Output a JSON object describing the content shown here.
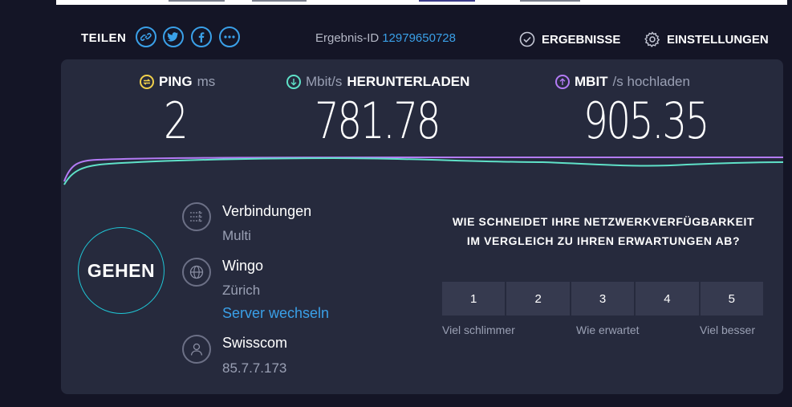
{
  "header": {
    "share_label": "TEILEN",
    "share_buttons": [
      {
        "icon": "link-icon",
        "glyph": "🔗"
      },
      {
        "icon": "twitter-icon",
        "glyph": "t"
      },
      {
        "icon": "facebook-icon",
        "glyph": "f"
      },
      {
        "icon": "more-icon",
        "glyph": "•••"
      }
    ],
    "result_id_label": "Ergebnis-ID",
    "result_id_value": "12979650728",
    "results_label": "ERGEBNISSE",
    "settings_label": "EINSTELLUNGEN"
  },
  "metrics": {
    "ping": {
      "title": "PING",
      "unit": "ms",
      "value": "2",
      "color": "#f1d04b"
    },
    "download": {
      "unit": "Mbit/s",
      "title": "HERUNTERLADEN",
      "value": "781.78",
      "color": "#5fe1c8"
    },
    "upload": {
      "title": "MBIT",
      "unit": "/s hochladen",
      "value": "905.35",
      "color": "#b37bf5"
    }
  },
  "go_label": "GEHEN",
  "connections": {
    "title": "Verbindungen",
    "value": "Multi"
  },
  "server": {
    "title": "Wingo",
    "location": "Zürich",
    "change_link": "Server wechseln"
  },
  "provider": {
    "title": "Swisscom",
    "ip": "85.7.7.173"
  },
  "survey": {
    "question": "WIE SCHNEIDET IHRE NETZWERKVERFÜGBARKEIT IM VERGLEICH ZU IHREN ERWARTUNGEN AB?",
    "options": [
      "1",
      "2",
      "3",
      "4",
      "5"
    ],
    "low_label": "Viel schlimmer",
    "mid_label": "Wie erwartet",
    "high_label": "Viel besser"
  },
  "colors": {
    "accent": "#3aa0e8",
    "go_ring": "#1fc6d6",
    "upload_line": "#b37bf5",
    "download_line": "#5fe1c8"
  }
}
